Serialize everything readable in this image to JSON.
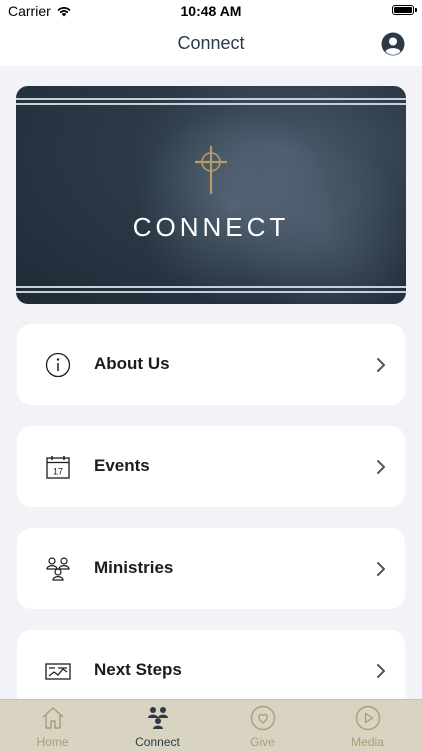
{
  "status_bar": {
    "carrier": "Carrier",
    "time": "10:48 AM"
  },
  "nav": {
    "title": "Connect"
  },
  "banner": {
    "title": "CONNECT"
  },
  "menu": [
    {
      "label": "About Us",
      "icon": "info-icon"
    },
    {
      "label": "Events",
      "icon": "calendar-icon",
      "calendar_day": "17"
    },
    {
      "label": "Ministries",
      "icon": "people-group-icon"
    },
    {
      "label": "Next Steps",
      "icon": "steps-icon"
    }
  ],
  "tabs": [
    {
      "label": "Home",
      "icon": "home-icon",
      "active": false
    },
    {
      "label": "Connect",
      "icon": "connect-icon",
      "active": true
    },
    {
      "label": "Give",
      "icon": "heart-icon",
      "active": false
    },
    {
      "label": "Media",
      "icon": "play-icon",
      "active": false
    }
  ],
  "colors": {
    "accent": "#2c3a48",
    "tab_inactive": "#a89d7a",
    "tab_bar_bg": "#d8d4c1",
    "cross_gold": "#b89a63"
  }
}
